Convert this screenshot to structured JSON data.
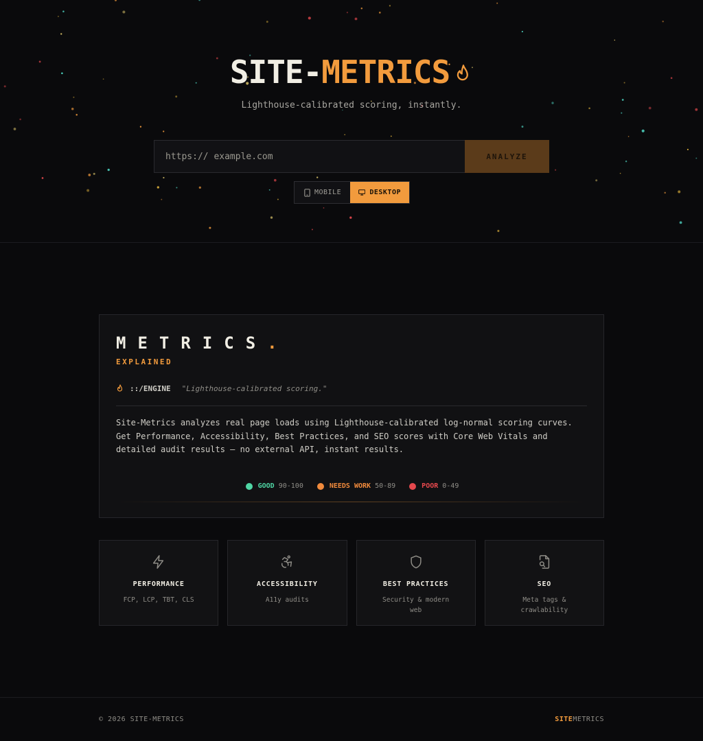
{
  "colors": {
    "accent": "#f29b3d",
    "good": "#4fd6a4",
    "needs_work": "#f08a3c",
    "poor": "#e5484d",
    "background": "#0a0a0c"
  },
  "hero": {
    "brand_part1": "SITE-",
    "brand_part2": "METRICS",
    "brand_icon": "flame-icon",
    "tagline": "Lighthouse-calibrated scoring, instantly.",
    "url_input_placeholder": "https:// example.com",
    "url_input_value": "",
    "analyze_label": "ANALYZE",
    "device_mobile_label": "MOBILE",
    "device_desktop_label": "DESKTOP",
    "device_selected": "DESKTOP"
  },
  "metrics_card": {
    "title": "METRICS",
    "title_dot": ".",
    "subtitle": "EXPLAINED",
    "engine_label": "::/ENGINE",
    "engine_quote": "\"Lighthouse-calibrated scoring.\"",
    "description": "Site-Metrics analyzes real page loads using Lighthouse-calibrated log-normal scoring curves. Get Performance, Accessibility, Best Practices, and SEO scores with Core Web Vitals and detailed audit results — no external API, instant results.",
    "legend": [
      {
        "label": "GOOD",
        "range": "90-100",
        "color": "#4fd6a4"
      },
      {
        "label": "NEEDS WORK",
        "range": "50-89",
        "color": "#f08a3c"
      },
      {
        "label": "POOR",
        "range": "0-49",
        "color": "#e5484d"
      }
    ]
  },
  "features": [
    {
      "icon": "lightning-icon",
      "title": "PERFORMANCE",
      "subtitle": "FCP, LCP, TBT, CLS"
    },
    {
      "icon": "accessibility-icon",
      "title": "ACCESSIBILITY",
      "subtitle": "A11y audits"
    },
    {
      "icon": "shield-icon",
      "title": "BEST PRACTICES",
      "subtitle": "Security & modern web"
    },
    {
      "icon": "file-search-icon",
      "title": "SEO",
      "subtitle": "Meta tags & crawlability"
    }
  ],
  "footer": {
    "copyright": "© 2026 SITE-METRICS",
    "logo_part1": "SITE",
    "logo_part2": "METRICS"
  }
}
